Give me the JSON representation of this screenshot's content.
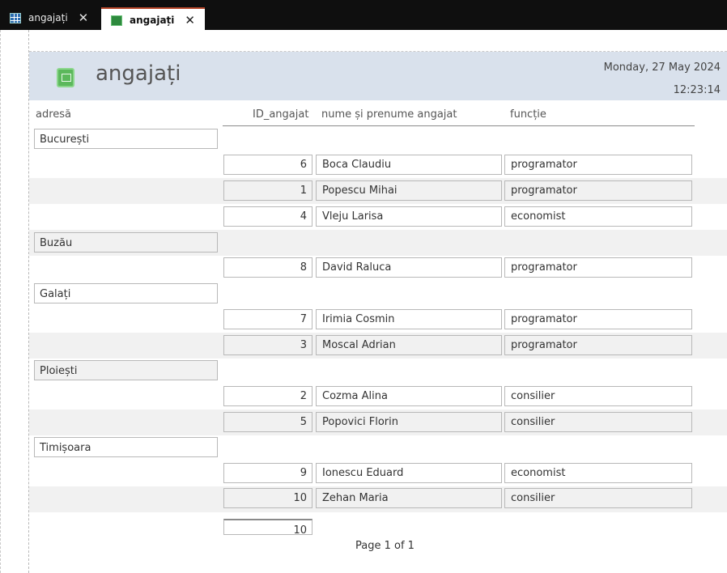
{
  "tabs": [
    {
      "label": "angajați",
      "icon": "table-icon"
    },
    {
      "label": "angajați",
      "icon": "report-icon"
    }
  ],
  "report": {
    "title": "angajați",
    "date": "Monday, 27 May 2024",
    "time": "12:23:14",
    "columns": [
      "adresă",
      "ID_angajat",
      "nume și prenume angajat",
      "funcție"
    ],
    "groups": [
      {
        "city": "București",
        "rows": [
          {
            "id": "6",
            "name": "Boca Claudiu",
            "job": "programator"
          },
          {
            "id": "1",
            "name": "Popescu Mihai",
            "job": "programator"
          },
          {
            "id": "4",
            "name": "Vleju Larisa",
            "job": "economist"
          }
        ]
      },
      {
        "city": "Buzău",
        "rows": [
          {
            "id": "8",
            "name": "David Raluca",
            "job": "programator"
          }
        ]
      },
      {
        "city": "Galați",
        "rows": [
          {
            "id": "7",
            "name": "Irimia Cosmin",
            "job": "programator"
          },
          {
            "id": "3",
            "name": "Moscal Adrian",
            "job": "programator"
          }
        ]
      },
      {
        "city": "Ploiești",
        "rows": [
          {
            "id": "2",
            "name": "Cozma Alina",
            "job": "consilier"
          },
          {
            "id": "5",
            "name": "Popovici Florin",
            "job": "consilier"
          }
        ]
      },
      {
        "city": "Timișoara",
        "rows": [
          {
            "id": "9",
            "name": "Ionescu Eduard",
            "job": "economist"
          },
          {
            "id": "10",
            "name": "Zehan Maria",
            "job": "consilier"
          }
        ]
      }
    ],
    "total": "10",
    "page_label": "Page 1 of 1"
  }
}
